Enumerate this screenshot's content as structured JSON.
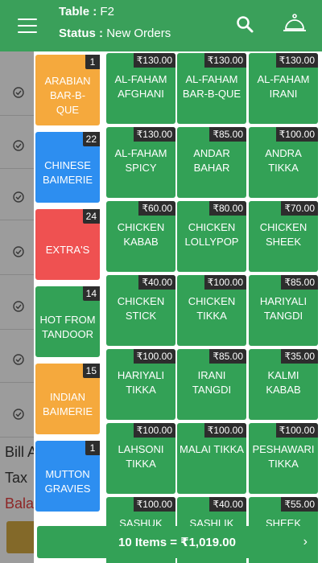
{
  "header": {
    "table_label": "Table :",
    "table_value": "F2",
    "status_label": "Status :",
    "status_value": "New Orders"
  },
  "background": {
    "bill_text": "Bill A",
    "tax_text": "Tax",
    "balance_text": "Bala"
  },
  "categories": [
    {
      "name": "Arabian Bar-B-Que",
      "count": "1",
      "color": "#f5a93d"
    },
    {
      "name": "Chinese Baimerie",
      "count": "22",
      "color": "#2d8ef0"
    },
    {
      "name": "Extra's",
      "count": "24",
      "color": "#ef5151"
    },
    {
      "name": "Hot From Tandoor",
      "count": "14",
      "color": "#33a156"
    },
    {
      "name": "Indian Baimerie",
      "count": "15",
      "color": "#f5a93d"
    },
    {
      "name": "Mutton Gravies",
      "count": "1",
      "color": "#2d8ef0"
    }
  ],
  "items": [
    {
      "name": "Al-Faham Afghani",
      "price": "₹130.00"
    },
    {
      "name": "Al-Faham Bar-B-Que",
      "price": "₹130.00"
    },
    {
      "name": "Al-Faham Irani",
      "price": "₹130.00"
    },
    {
      "name": "Al-Faham Spicy",
      "price": "₹130.00"
    },
    {
      "name": "Andar Bahar",
      "price": "₹85.00"
    },
    {
      "name": "Andra Tikka",
      "price": "₹100.00"
    },
    {
      "name": "Chicken Kabab",
      "price": "₹60.00"
    },
    {
      "name": "Chicken Lollypop",
      "price": "₹80.00"
    },
    {
      "name": "Chicken Sheek",
      "price": "₹70.00"
    },
    {
      "name": "Chicken Stick",
      "price": "₹40.00"
    },
    {
      "name": "Chicken Tikka",
      "price": "₹100.00"
    },
    {
      "name": "Hariyali Tangdi",
      "price": "₹85.00"
    },
    {
      "name": "Hariyali Tikka",
      "price": "₹100.00"
    },
    {
      "name": "Irani Tangdi",
      "price": "₹85.00"
    },
    {
      "name": "Kalmi Kabab",
      "price": "₹35.00"
    },
    {
      "name": "Lahsoni Tikka",
      "price": "₹100.00"
    },
    {
      "name": "Malai Tikka",
      "price": "₹100.00"
    },
    {
      "name": "Peshawari Tikka",
      "price": "₹100.00"
    },
    {
      "name": "Sashuk",
      "price": "₹100.00"
    },
    {
      "name": "Sashlik",
      "price": "₹40.00"
    },
    {
      "name": "Sheek",
      "price": "₹55.00"
    }
  ],
  "cart": {
    "summary": "10 Items = ₹1,019.00",
    "chevron": "›"
  },
  "icons": {
    "menu": "hamburger-icon",
    "search": "search-icon",
    "bell": "service-bell-icon",
    "check": "check-circle-icon"
  },
  "colors": {
    "primary": "#3aa05a",
    "item_tile": "#33a156",
    "badge": "#2d2d2d"
  }
}
